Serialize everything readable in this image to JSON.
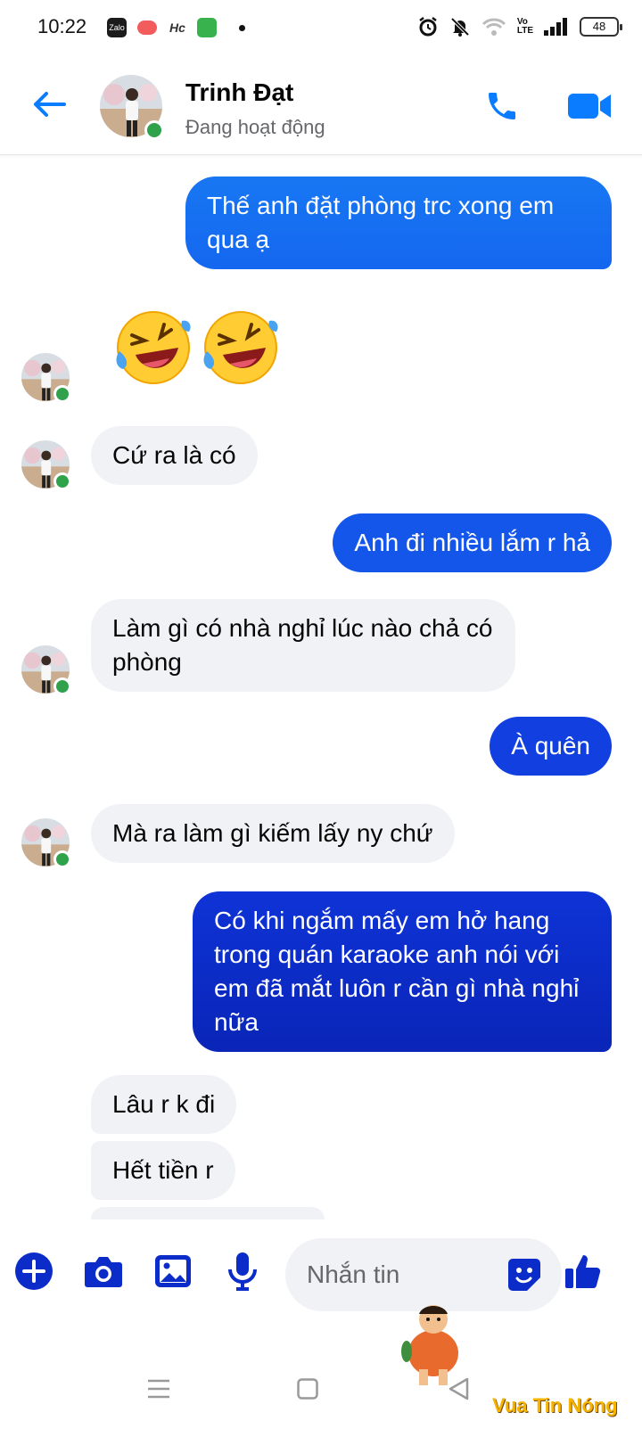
{
  "status_bar": {
    "time": "10:22",
    "battery": "48",
    "icons": [
      "zalo-icon",
      "game-icon",
      "app-icon",
      "store-icon",
      "dot-icon",
      "alarm-icon",
      "mute-icon",
      "wifi-icon",
      "volte-icon",
      "signal-icon",
      "battery-icon"
    ]
  },
  "header": {
    "name": "Trinh Đạt",
    "status": "Đang hoạt động"
  },
  "messages": [
    {
      "side": "out",
      "text": "Thế anh đặt phòng trc xong em qua ạ"
    },
    {
      "side": "in",
      "type": "emoji",
      "content": "😂😂"
    },
    {
      "side": "in",
      "text": "Cứ ra là có"
    },
    {
      "side": "out",
      "text": "Anh đi nhiều lắm r hả"
    },
    {
      "side": "in",
      "text": "Làm gì có nhà nghỉ lúc nào chả có phòng"
    },
    {
      "side": "out",
      "text": "À quên"
    },
    {
      "side": "in",
      "text": "Mà ra làm gì kiếm lấy ny chứ"
    },
    {
      "side": "out",
      "text": "Có khi ngắm mấy em hở hang trong quán karaoke anh nói với em đã mắt luôn r cần gì nhà nghỉ nữa"
    },
    {
      "side": "in",
      "text": "Lâu r k đi"
    },
    {
      "side": "in",
      "text": "Hết tiền r"
    }
  ],
  "composer": {
    "placeholder": "Nhắn tin"
  },
  "watermark": "Vua Tin Nóng",
  "colors": {
    "accent": "#0a7cff",
    "bubble_top": "#1877f2",
    "bubble_bottom": "#0b2cc8",
    "online": "#31a24c"
  }
}
